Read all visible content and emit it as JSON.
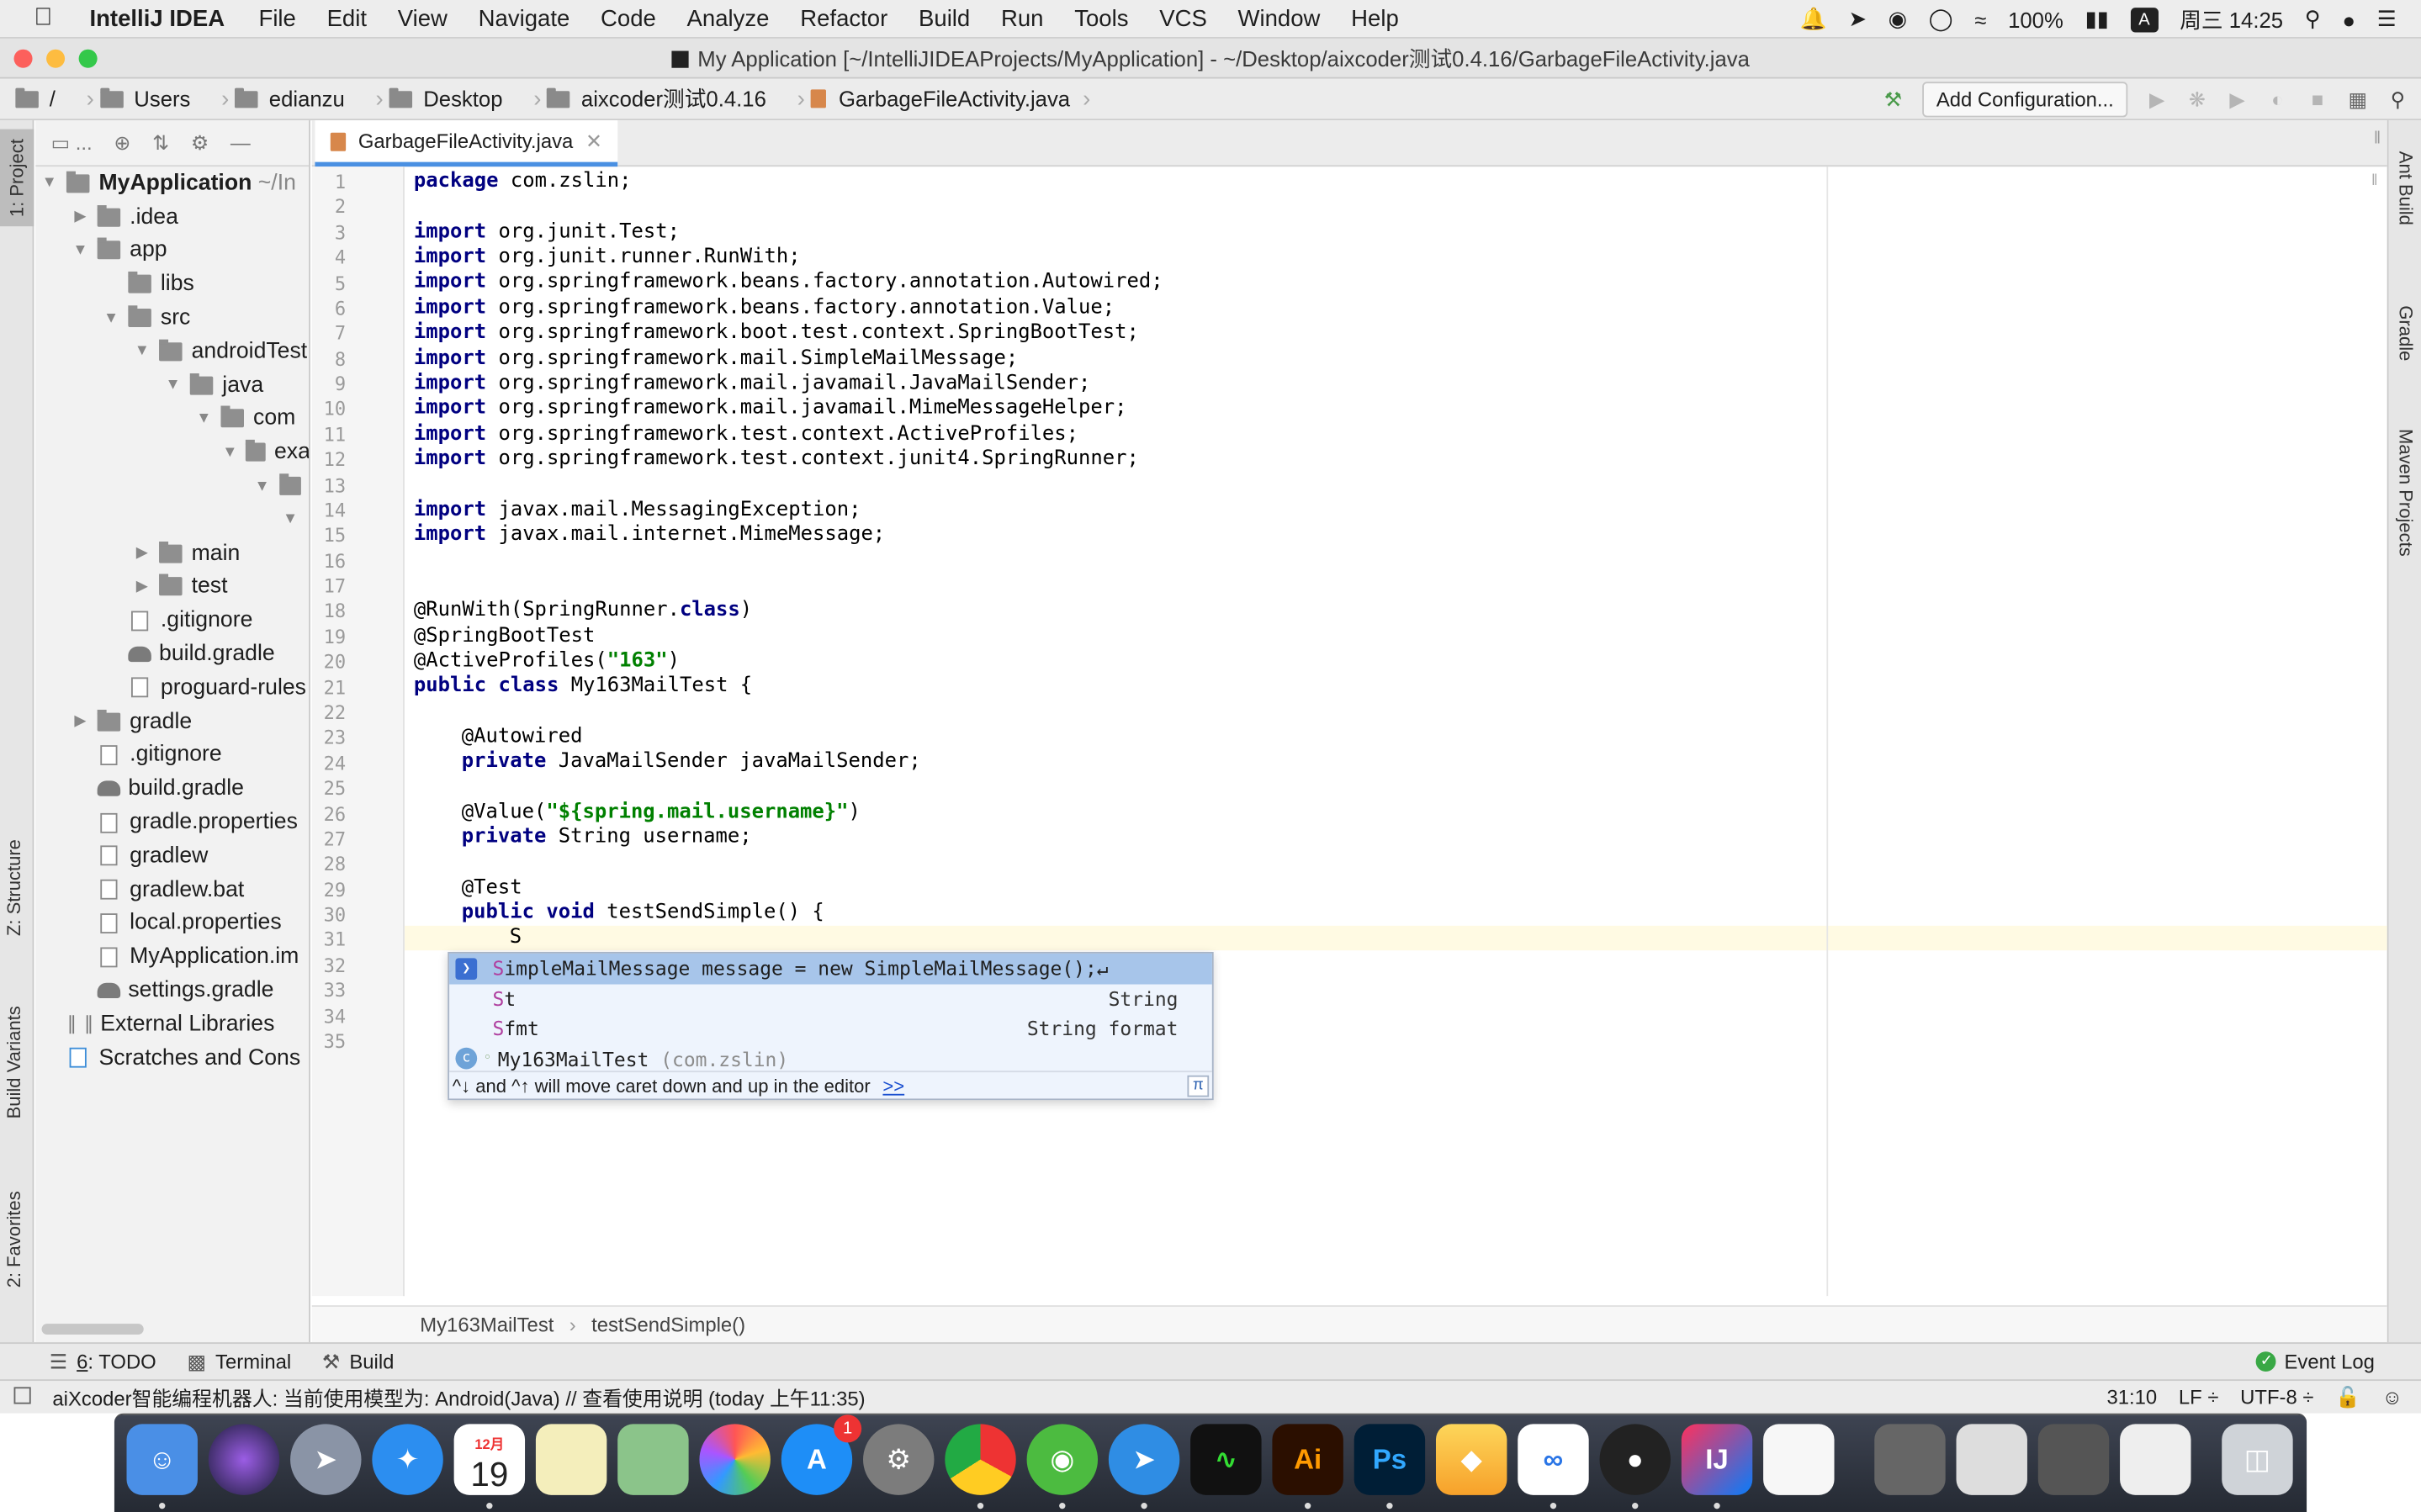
{
  "menubar": {
    "app_name": "IntelliJ IDEA",
    "items": [
      "File",
      "Edit",
      "View",
      "Navigate",
      "Code",
      "Analyze",
      "Refactor",
      "Build",
      "Run",
      "Tools",
      "VCS",
      "Window",
      "Help"
    ],
    "battery": "100%",
    "input_method": "A",
    "clock": "周三 14:25"
  },
  "window": {
    "title": "My Application [~/IntelliJIDEAProjects/MyApplication] - ~/Desktop/aixcoder测试0.4.16/GarbageFileActivity.java"
  },
  "navbar": {
    "crumbs": [
      "/",
      "Users",
      "edianzu",
      "Desktop",
      "aixcoder测试0.4.16",
      "GarbageFileActivity.java"
    ],
    "add_configuration": "Add Configuration..."
  },
  "left_strip": {
    "project": "1: Project",
    "structure": "Z: Structure",
    "build_variants": "Build Variants",
    "favorites": "2: Favorites"
  },
  "right_strip": {
    "ant": "Ant Build",
    "gradle": "Gradle",
    "maven": "Maven Projects"
  },
  "project_panel": {
    "toolbar_label": "...",
    "root_name": "MyApplication",
    "root_path": "~/In",
    "nodes": [
      {
        "label": ".idea"
      },
      {
        "label": "app"
      },
      {
        "label": "libs"
      },
      {
        "label": "src"
      },
      {
        "label": "androidTest"
      },
      {
        "label": "java"
      },
      {
        "label": "com"
      },
      {
        "label": "exa"
      },
      {
        "label": ""
      },
      {
        "label": ""
      },
      {
        "label": "main"
      },
      {
        "label": "test"
      },
      {
        "label": ".gitignore"
      },
      {
        "label": "build.gradle"
      },
      {
        "label": "proguard-rules"
      },
      {
        "label": "gradle"
      },
      {
        "label": ".gitignore"
      },
      {
        "label": "build.gradle"
      },
      {
        "label": "gradle.properties"
      },
      {
        "label": "gradlew"
      },
      {
        "label": "gradlew.bat"
      },
      {
        "label": "local.properties"
      },
      {
        "label": "MyApplication.im"
      },
      {
        "label": "settings.gradle"
      },
      {
        "label": "External Libraries"
      },
      {
        "label": "Scratches and Cons"
      }
    ]
  },
  "editor": {
    "tab_label": "GarbageFileActivity.java",
    "line_numbers": [
      "1",
      "2",
      "3",
      "4",
      "5",
      "6",
      "7",
      "8",
      "9",
      "10",
      "11",
      "12",
      "13",
      "14",
      "15",
      "16",
      "17",
      "18",
      "19",
      "20",
      "21",
      "22",
      "23",
      "24",
      "25",
      "26",
      "27",
      "28",
      "29",
      "30",
      "31",
      "32",
      "33",
      "34",
      "35"
    ],
    "code": {
      "l1": "com.zslin;",
      "l3": "org.junit.Test;",
      "l4": "org.junit.runner.RunWith;",
      "l5": "org.springframework.beans.factory.annotation.Autowired;",
      "l6": "org.springframework.beans.factory.annotation.Value;",
      "l7": "org.springframework.boot.test.context.SpringBootTest;",
      "l8": "org.springframework.mail.SimpleMailMessage;",
      "l9": "org.springframework.mail.javamail.JavaMailSender;",
      "l10": "org.springframework.mail.javamail.MimeMessageHelper;",
      "l11": "org.springframework.test.context.ActiveProfiles;",
      "l12": "org.springframework.test.context.junit4.SpringRunner;",
      "l14": "javax.mail.MessagingException;",
      "l15": "javax.mail.internet.MimeMessage;",
      "l18a": "@RunWith(SpringRunner.",
      "l18b": "class",
      "l18c": ")",
      "l19": "@SpringBootTest",
      "l20a": "@ActiveProfiles(",
      "l20b": "\"163\"",
      "l20c": ")",
      "l21": "My163MailTest {",
      "l23": "@Autowired",
      "l24": "JavaMailSender javaMailSender;",
      "l26a": "@Value(",
      "l26b": "\"${spring.mail.username}\"",
      "l26c": ")",
      "l27": "String username;",
      "l29": "@Test",
      "l30": "testSendSimple() {",
      "l31": "S"
    },
    "kw": {
      "package": "package",
      "import": "import",
      "public": "public",
      "class": "class",
      "private": "private",
      "void": "void"
    },
    "breadcrumb_class": "My163MailTest",
    "breadcrumb_method": "testSendSimple()"
  },
  "completion": {
    "items": [
      {
        "match": "S",
        "rest": "impleMailMessage message = new SimpleMailMessage();↵",
        "type": ""
      },
      {
        "match": "S",
        "rest": "t",
        "type": "String"
      },
      {
        "match": "S",
        "rest": "fmt",
        "type": "String format"
      },
      {
        "match": "",
        "rest": "My163MailTest",
        "extra": "(com.zslin)",
        "type": ""
      }
    ],
    "hint": "^↓ and ^↑ will move caret down and up in the editor",
    "hint_link": ">>",
    "pi": "π"
  },
  "bottom_tools": {
    "todo_num": "6",
    "todo": ": TODO",
    "terminal": "Terminal",
    "build": "Build",
    "event_log": "Event Log"
  },
  "status": {
    "message": "aiXcoder智能编程机器人: 当前使用模型为: Android(Java) // 查看使用说明 (today 上午11:35)",
    "position": "31:10",
    "line_sep": "LF ÷",
    "encoding": "UTF-8 ÷"
  },
  "dock": {
    "calendar_month": "12月",
    "calendar_day": "19",
    "appstore_badge": "1",
    "illustrator": "Ai",
    "photoshop": "Ps",
    "intellij": "IJ"
  }
}
